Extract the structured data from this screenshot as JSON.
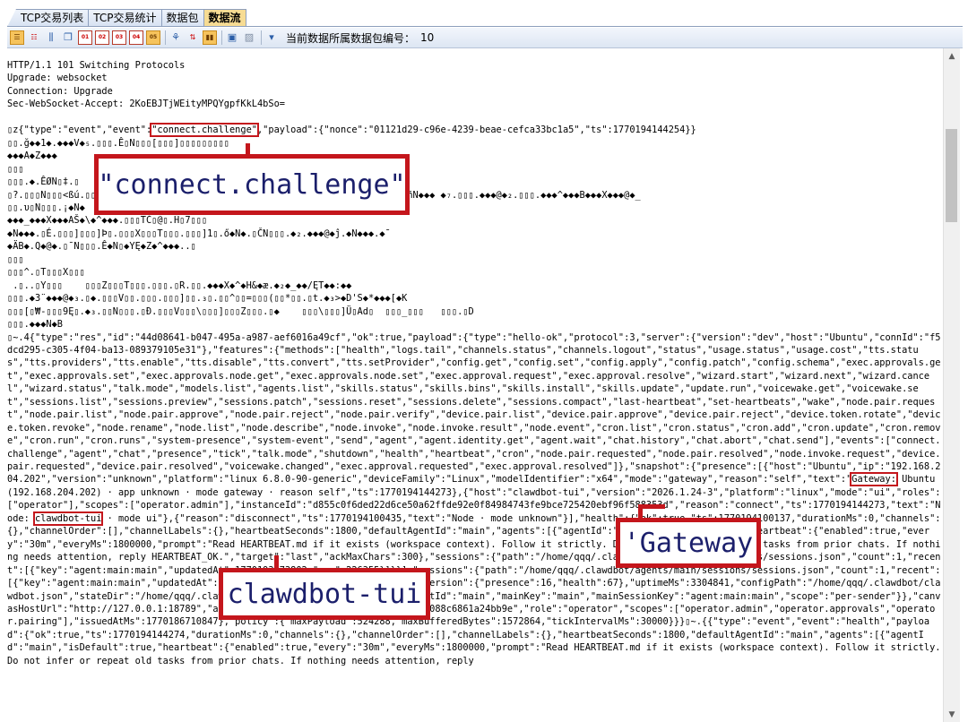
{
  "tabs": [
    {
      "label": "TCP交易列表",
      "active": false
    },
    {
      "label": "TCP交易统计",
      "active": false
    },
    {
      "label": "数据包",
      "active": false
    },
    {
      "label": "数据流",
      "active": true
    }
  ],
  "toolbar": {
    "icons": [
      "align-left-icon",
      "align-split-icon",
      "columns-icon",
      "copy-icon",
      "hex-view-icon",
      "text-view-icon",
      "binary-view-icon",
      "raw-view-icon",
      "decode-view-icon",
      "tree-icon",
      "sort-icon",
      "chart-icon",
      "frame-icon",
      "image-icon",
      "export-icon"
    ],
    "packet_label": "当前数据所属数据包编号：",
    "packet_value": "10"
  },
  "stream_lines": [
    "HTTP/1.1 101 Switching Protocols",
    "Upgrade: websocket",
    "Connection: Upgrade",
    "Sec-WebSocket-Accept: 2KoEBJTjWEityMPQYgpfKkL4bSo=",
    "",
    "|__HL1__|",
    "▯▯.ğ◆◆1◆.◆◆◆V◆₅.▯▯▯.Ê▯N▯▯▯[▯▯▯]▯▯▯▯▯▯▯▯▯",
    "◆◆◆A◆Z◆◆◆",
    "▯▯▯",
    "▯▯▯.◆.ÊØN▯‡.▯",
    "▯?.▯▯▯N▯▯▯<ßú.▯▯▯▯▯▯▯▯▯▯▯▯▯▯▯▯▯▯▯▯▯▯▯▯▯▯▯▯▯▯▯▯▯▯▯▯▯▯▯▯▯▯▯▯▯▯▯▯▯▯▯▯▯▯▯▯▯◆ñN◆◆◆ ◆₇.▯▯▯.◆◆◆@◆₂.▯▯▯.◆◆◆^◆◆◆B◆◆◆X◆◆◆@◆_",
    "▯▯.υ▯N▯▯▯.¡◆N◆",
    "◆◆◆_◆◆◆X◆◆◆AŠ◆\\◆^◆◆◆.▯▯▯TĆ▯@▯.Ḣ▯7▯▯▯",
    "◆N◆◆◆.▯É.▯▯▯]▯▯▯]Þ▯.▯▯▯X▯▯▯T▯▯▯.▯▯▯]1▯.ő◆N◆.▯ČN▯▯▯.◆₂.◆◆◆@◆ĵ.◆N◆◆◆.◆¯",
    "◆ÄB◆.Q◆@◆.▯¯N▯▯▯.Ê◆N▯◆YĘ◆Z◆^◆◆◆..▯",
    "▯▯▯",
    "▯▯▯^.▯T▯▯▯X▯▯▯",
    " .▯..▯Y▯▯▯    ▯▯▯Z▯▯▯T▯▯▯.▯▯▯.▯R.▯▯.◆◆◆X◆^◆H&◆æ.◆₂◆_◆◆/ĘT◆◆:◆◆",
    "▯▯▯.◆3̈ ◆◆◆@◆₃.▯◆.▯▯▯V▯▯.▯▯▯.▯▯▯]▯▯.₃▯.▯▯^▯▯=▯▯▯(▯▯*▯▯.▯t.◆₃>◆D'S◆*◆◆◆[◆K",
    "▯▯▯[▯₩-▯▯▯9Ę▯.◆₃.▯▯N▯▯▯.▯Ð.▯▯▯V▯▯▯\\▯▯▯]▯▯▯Z▯▯▯.▯◆    ▯▯▯\\▯▯▯]Ü▯Ad▯  ▯▯▯_▯▯▯   ▯▯▯.▯D",
    "▯▯▯.◆◆◆N◆B",
    "▯~.4{\"type\":\"res\",\"id\":\"44d08641-b047-495a-a987-aef6016a49cf\",\"ok\":true,\"payload\":{\"type\":\"hello-ok\",\"protocol\":3,\"server\":{\"version\":\"dev\",\"host\":\"Ubuntu\",\"connId\":\"f5dcd295-c305-4f04-ba13-089379105e31\"},\"features\":{\"methods\":[\"health\",\"logs.tail\",\"channels.status\",\"channels.logout\",\"status\",\"usage.status\",\"usage.cost\",\"tts.status\",\"tts.providers\",\"tts.enable\",\"tts.disable\",\"tts.convert\",\"tts.setProvider\",\"config.get\",\"config.set\",\"config.apply\",\"config.patch\",\"config.schema\",\"exec.approvals.get\",\"exec.approvals.set\",\"exec.approvals.node.get\",\"exec.approvals.node.set\",\"exec.approval.request\",\"exec.approval.resolve\",\"wizard.start\",\"wizard.next\",\"wizard.cancel\",\"wizard.status\",\"talk.mode\",\"models.list\",\"agents.list\",\"skills.status\",\"skills.bins\",\"skills.install\",\"skills.update\",\"update.run\",\"voicewake.get\",\"voicewake.set\",\"sessions.list\",\"sessions.preview\",\"sessions.patch\",\"sessions.reset\",\"sessions.delete\",\"sessions.compact\",\"last-heartbeat\",\"set-heartbeats\",\"wake\",\"node.pair.request\",\"node.pair.list\",\"node.pair.approve\",\"node.pair.reject\",\"node.pair.verify\",\"device.pair.list\",\"device.pair.approve\",\"device.pair.reject\",\"device.token.rotate\",\"device.token.revoke\",\"node.rename\",\"node.list\",\"node.describe\",\"node.invoke\",\"node.invoke.result\",\"node.event\",\"cron.list\",\"cron.status\",\"cron.add\",\"cron.update\",\"cron.remove\",\"cron.run\",\"cron.runs\",\"system-presence\",\"system-event\",\"send\",\"agent\",\"agent.identity.get\",\"agent.wait\",\"chat.history\",\"chat.abort\",\"chat.send\"],\"events\":[\"connect.challenge\",\"agent\",\"chat\",\"presence\",\"tick\",\"talk.mode\",\"shutdown\",\"health\",\"heartbeat\",\"cron\",\"node.pair.requested\",\"node.pair.resolved\",\"node.invoke.request\",\"device.pair.requested\",\"device.pair.resolved\",\"voicewake.changed\",\"exec.approval.requested\",\"exec.approval.resolved\"]},\"snapshot\":{\"presence\":[{\"host\":\"Ubuntu\",\"ip\":\"192.168.204.202\",\"version\":\"unknown\",\"platform\":\"linux 6.8.0-90-generic\",\"deviceFamily\":\"Linux\",\"modelIdentifier\":\"x64\",\"mode\":\"gateway\",\"reason\":\"self\",\"text\":\"|__HL2__| Ubuntu (192.168.204.202) · app unknown · mode gateway · reason self\",\"ts\":1770194144273},{\"host\":\"clawdbot-tui\",\"version\":\"2026.1.24-3\",\"platform\":\"linux\",\"mode\":\"ui\",\"roles\":[\"operator\"],\"scopes\":[\"operator.admin\"],\"instanceId\":\"d855c0f6ded22d6ce50a62ffde92e0f84984743fe9bce725420ebf96f588353d\",\"reason\":\"connect\",\"ts\":1770194144273,\"text\":\"Node: |__HL3__| · mode ui\"},{\"reason\":\"disconnect\",\"ts\":1770194100435,\"text\":\"Node · mode unknown\"}],\"health\":{\"ok\":true,\"ts\":1770194100137,\"durationMs\":0,\"channels\":{},\"channelOrder\":[],\"channelLabels\":{},\"heartbeatSeconds\":1800,\"defaultAgentId\":\"main\",\"agents\":[{\"agentId\":\"main\",\"isDefault\":true,\"heartbeat\":{\"enabled\":true,\"every\":\"30m\",\"everyMs\":1800000,\"prompt\":\"Read HEARTBEAT.md if it exists (workspace context). Follow it strictly. Do not infer or repeat old tasks from prior chats. If nothing needs attention, reply HEARTBEAT_OK.\",\"target\":\"last\",\"ackMaxChars\":300},\"sessions\":{\"path\":\"/home/qqq/.clawdbot/agents/main/sessions/sessions.json\",\"count\":1,\"recent\":[{\"key\":\"agent:main:main\",\"updatedAt\":1770193873802,\"age\":226355}]}}],\"sessions\":{\"path\":\"/home/qqq/.clawdbot/agents/main/sessions/sessions.json\",\"count\":1,\"recent\":[{\"key\":\"agent:main:main\",\"updatedAt\":1770193873802,\"age\":226355}]}},\"stateVersion\":{\"presence\":16,\"health\":67},\"uptimeMs\":3304841,\"configPath\":\"/home/qqq/.clawdbot/clawdbot.json\",\"stateDir\":\"/home/qqq/.clawdbot\",\"sessionDefaults\":{\"defaultAgentId\":\"main\",\"mainKey\":\"main\",\"mainSessionKey\":\"agent:main:main\",\"scope\":\"per-sender\"}},\"canvasHostUrl\":\"http://127.0.0.1:18789\",\"auth\":{\"deviceToken\":\"13d71d69b0784f648088c6861a24bb9e\",\"role\":\"operator\",\"scopes\":[\"operator.admin\",\"operator.approvals\",\"operator.pairing\"],\"issuedAtMs\":1770186710847},\"policy\":{\"maxPayload\":524288,\"maxBufferedBytes\":1572864,\"tickIntervalMs\":30000}}}▯~.{{\"type\":\"event\",\"event\":\"health\",\"payload\":{\"ok\":true,\"ts\":1770194144274,\"durationMs\":0,\"channels\":{},\"channelOrder\":[],\"channelLabels\":{},\"heartbeatSeconds\":1800,\"defaultAgentId\":\"main\",\"agents\":[{\"agentId\":\"main\",\"isDefault\":true,\"heartbeat\":{\"enabled\":true,\"every\":\"30m\",\"everyMs\":1800000,\"prompt\":\"Read HEARTBEAT.md if it exists (workspace context). Follow it strictly. Do not infer or repeat old tasks from prior chats. If nothing needs attention, reply"
  ],
  "first_event": {
    "prefix": "▯z{\"type\":\"event\",\"event\":",
    "highlight": "\"connect.challenge\"",
    "suffix": ",\"payload\":{\"nonce\":\"01121d29-c96e-4239-beae-cefca33bc1a5\",\"ts\":1770194144254}}"
  },
  "highlights": {
    "gateway_inline": "Gateway:",
    "clawdbot_inline": "clawdbot-tui"
  },
  "callouts": {
    "connect_challenge": "\"connect.challenge\"",
    "gateway": "'Gateway",
    "clawdbot": "clawdbot-tui"
  },
  "scrollbar": {
    "up": "▲",
    "down": "▼"
  }
}
